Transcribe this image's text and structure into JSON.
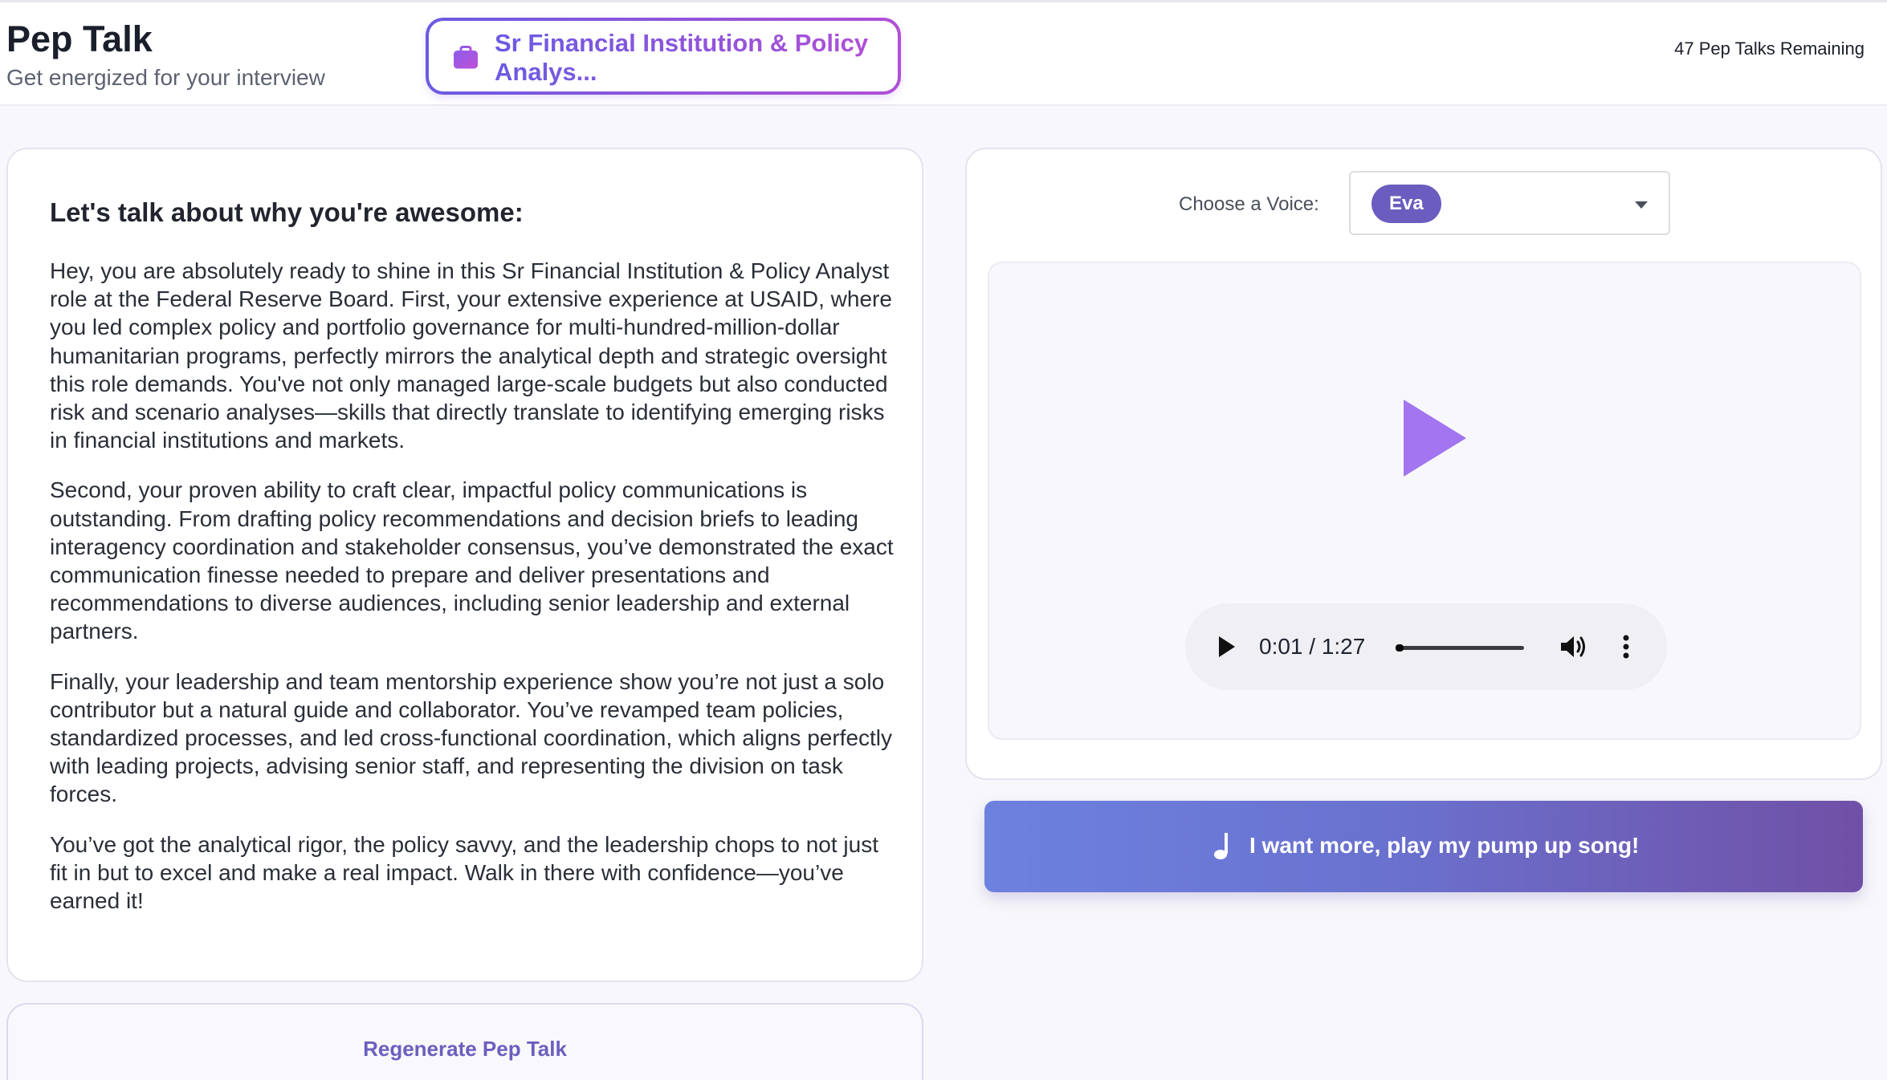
{
  "header": {
    "title": "Pep Talk",
    "subtitle": "Get energized for your interview",
    "job_pill": "Sr Financial Institution & Policy Analys...",
    "remaining": "47 Pep Talks Remaining"
  },
  "pep_talk": {
    "heading": "Let's talk about why you're awesome:",
    "paragraphs": [
      "Hey, you are absolutely ready to shine in this Sr Financial Institution & Policy Analyst role at the Federal Reserve Board. First, your extensive experience at USAID, where you led complex policy and portfolio governance for multi-hundred-million-dollar humanitarian programs, perfectly mirrors the analytical depth and strategic oversight this role demands. You've not only managed large-scale budgets but also conducted risk and scenario analyses—skills that directly translate to identifying emerging risks in financial institutions and markets.",
      "Second, your proven ability to craft clear, impactful policy communications is outstanding. From drafting policy recommendations and decision briefs to leading interagency coordination and stakeholder consensus, you’ve demonstrated the exact communication finesse needed to prepare and deliver presentations and recommendations to diverse audiences, including senior leadership and external partners.",
      "Finally, your leadership and team mentorship experience show you’re not just a solo contributor but a natural guide and collaborator. You’ve revamped team policies, standardized processes, and led cross-functional coordination, which aligns perfectly with leading projects, advising senior staff, and representing the division on task forces.",
      "You’ve got the analytical rigor, the policy savvy, and the leadership chops to not just fit in but to excel and make a real impact. Walk in there with confidence—you’ve earned it!"
    ],
    "regenerate_label": "Regenerate Pep Talk"
  },
  "voice": {
    "label": "Choose a Voice:",
    "selected": "Eva"
  },
  "audio": {
    "time": "0:01 / 1:27",
    "progress_fraction": 0.06
  },
  "pump_button": {
    "label": "I want more, play my pump up song!"
  },
  "colors": {
    "accent_purple": "#6b5dbf",
    "play_purple": "#a375f0",
    "gradient_start": "#6d81df",
    "gradient_end": "#7050a6"
  },
  "icons": [
    "briefcase-icon",
    "play-icon",
    "volume-icon",
    "more-vertical-icon",
    "music-note-icon",
    "chevron-down-icon"
  ]
}
